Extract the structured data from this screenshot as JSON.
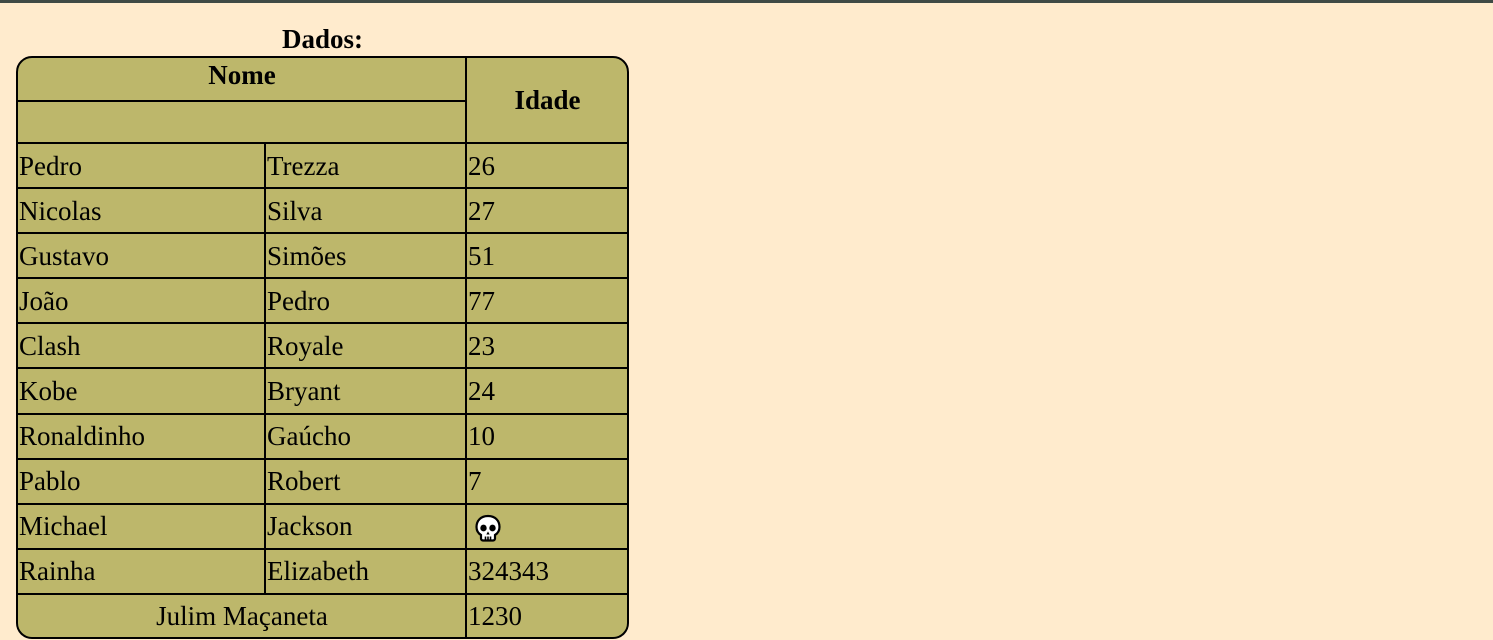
{
  "table": {
    "caption": "Dados:",
    "headers": {
      "nome": "Nome",
      "idade": "Idade"
    },
    "rows": [
      {
        "first": "Pedro",
        "last": "Trezza",
        "age": "26"
      },
      {
        "first": "Nicolas",
        "last": "Silva",
        "age": "27"
      },
      {
        "first": "Gustavo",
        "last": "Simões",
        "age": "51"
      },
      {
        "first": "João",
        "last": "Pedro",
        "age": "77"
      },
      {
        "first": "Clash",
        "last": "Royale",
        "age": "23"
      },
      {
        "first": "Kobe",
        "last": "Bryant",
        "age": "24"
      },
      {
        "first": "Ronaldinho",
        "last": "Gaúcho",
        "age": "10"
      },
      {
        "first": "Pablo",
        "last": "Robert",
        "age": "7"
      },
      {
        "first": "Michael",
        "last": "Jackson",
        "age_icon": "skull-icon"
      },
      {
        "first": "Rainha",
        "last": "Elizabeth",
        "age": "324343"
      }
    ],
    "footer": {
      "name": "Julim Maçaneta",
      "age": "1230"
    }
  },
  "colors": {
    "page_background": "#FFEBCD",
    "table_background": "#BDB76B",
    "border": "#000000",
    "top_bar": "#3F4A45"
  }
}
